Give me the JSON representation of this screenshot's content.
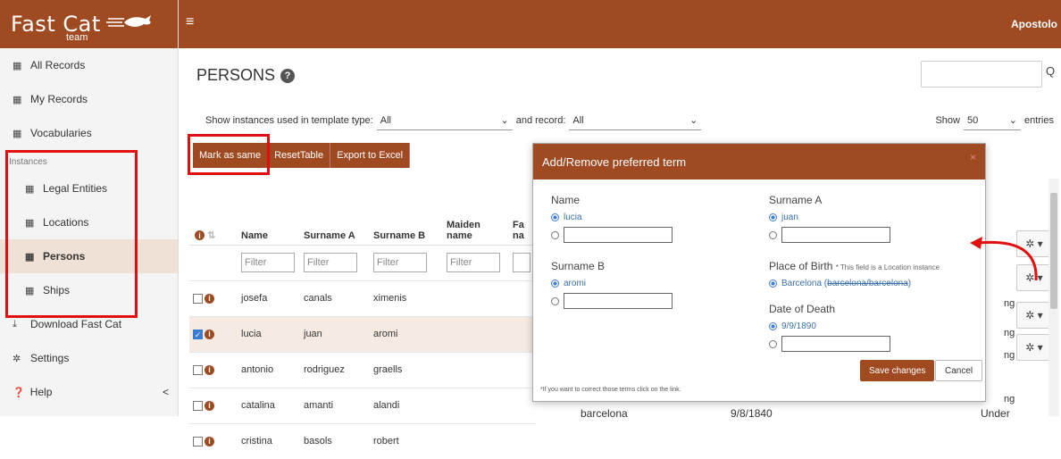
{
  "brand": {
    "name": "Fast Cat",
    "sub": "team"
  },
  "topbar": {
    "user": "Apostolo"
  },
  "sidebar": {
    "items": [
      {
        "label": "All Records",
        "icon": "table-icon"
      },
      {
        "label": "My Records",
        "icon": "table-icon"
      },
      {
        "label": "Vocabularies",
        "icon": "table-icon"
      }
    ],
    "section": "Instances",
    "sub_items": [
      {
        "label": "Legal Entities"
      },
      {
        "label": "Locations"
      },
      {
        "label": "Persons"
      },
      {
        "label": "Ships"
      }
    ],
    "download": "Download Fast Cat",
    "settings": "Settings",
    "help": "Help",
    "help_chevron": "<"
  },
  "page": {
    "title": "PERSONS",
    "search_icon": "Q"
  },
  "filters": {
    "template_label": "Show instances used in template type:",
    "template_value": "All",
    "record_label": "and record:",
    "record_value": "All",
    "show_label": "Show",
    "show_value": "50",
    "entries_label": "entries"
  },
  "buttons": {
    "mark_same": "Mark as same",
    "reset": "ResetTable",
    "export": "Export to Excel"
  },
  "table": {
    "headers": [
      "Name",
      "Surname A",
      "Surname B",
      "Maiden name",
      "Fa na"
    ],
    "filter_placeholder": "Filter",
    "rows": [
      {
        "name": "josefa",
        "surname_a": "canals",
        "surname_b": "ximenis",
        "checked": false
      },
      {
        "name": "lucia",
        "surname_a": "juan",
        "surname_b": "aromi",
        "checked": true
      },
      {
        "name": "antonio",
        "surname_a": "rodriguez",
        "surname_b": "graells",
        "checked": false
      },
      {
        "name": "catalina",
        "surname_a": "amanti",
        "surname_b": "alandi",
        "checked": false
      },
      {
        "name": "cristina",
        "surname_a": "basols",
        "surname_b": "robert",
        "checked": false
      }
    ],
    "partial": {
      "place": "barcelona",
      "date": "9/8/1840",
      "status": "Under",
      "ng": "ng"
    }
  },
  "modal": {
    "title": "Add/Remove preferred term",
    "close": "×",
    "name": {
      "label": "Name",
      "option": "lucia"
    },
    "surname_a": {
      "label": "Surname A",
      "option": "juan"
    },
    "surname_b": {
      "label": "Surname B",
      "option": "aromi"
    },
    "place_of_birth": {
      "label": "Place of Birth",
      "hint": "* This field is a Location instance",
      "option": "Barcelona (",
      "option_strike": "barcelona/barcelona",
      "option_end": ")"
    },
    "date_of_death": {
      "label": "Date of Death",
      "option": "9/9/1890"
    },
    "save": "Save changes",
    "cancel": "Cancel",
    "footnote": "*If you want to correct those terms click on the link."
  },
  "colors": {
    "brand": "#a04a22",
    "highlight": "#e01010",
    "link": "#3a6fa8"
  }
}
